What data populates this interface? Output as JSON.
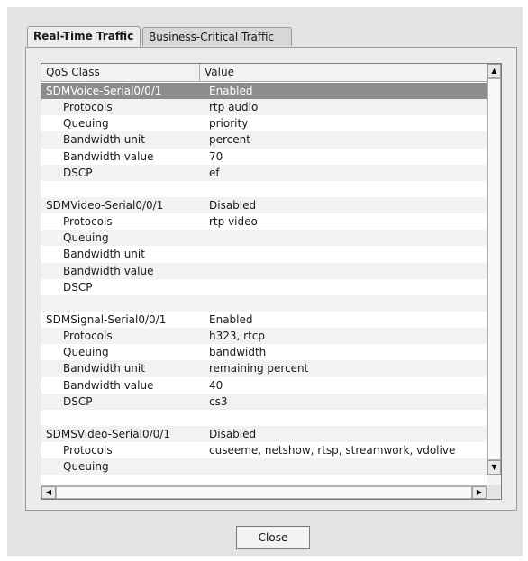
{
  "tabs": [
    {
      "label": "Real-Time Traffic",
      "active": true
    },
    {
      "label": "Business-Critical Traffic",
      "active": false
    }
  ],
  "table": {
    "columns": [
      "QoS Class",
      "Value"
    ],
    "rows": [
      {
        "key": "SDMVoice-Serial0/0/1",
        "value": "Enabled",
        "level": 0,
        "selected": true
      },
      {
        "key": "Protocols",
        "value": "rtp audio",
        "level": 1
      },
      {
        "key": "Queuing",
        "value": "priority",
        "level": 1
      },
      {
        "key": "Bandwidth unit",
        "value": "percent",
        "level": 1
      },
      {
        "key": "Bandwidth value",
        "value": "70",
        "level": 1
      },
      {
        "key": "DSCP",
        "value": "ef",
        "level": 1
      },
      {
        "key": "",
        "value": "",
        "level": 0
      },
      {
        "key": "SDMVideo-Serial0/0/1",
        "value": "Disabled",
        "level": 0
      },
      {
        "key": "Protocols",
        "value": "rtp video",
        "level": 1
      },
      {
        "key": "Queuing",
        "value": "",
        "level": 1
      },
      {
        "key": "Bandwidth unit",
        "value": "",
        "level": 1
      },
      {
        "key": "Bandwidth value",
        "value": "",
        "level": 1
      },
      {
        "key": "DSCP",
        "value": "",
        "level": 1
      },
      {
        "key": "",
        "value": "",
        "level": 0
      },
      {
        "key": "SDMSignal-Serial0/0/1",
        "value": "Enabled",
        "level": 0
      },
      {
        "key": "Protocols",
        "value": "h323, rtcp",
        "level": 1
      },
      {
        "key": "Queuing",
        "value": "bandwidth",
        "level": 1
      },
      {
        "key": "Bandwidth unit",
        "value": "remaining percent",
        "level": 1
      },
      {
        "key": "Bandwidth value",
        "value": "40",
        "level": 1
      },
      {
        "key": "DSCP",
        "value": "cs3",
        "level": 1
      },
      {
        "key": "",
        "value": "",
        "level": 0
      },
      {
        "key": "SDMSVideo-Serial0/0/1",
        "value": "Disabled",
        "level": 0
      },
      {
        "key": "Protocols",
        "value": "cuseeme, netshow, rtsp, streamwork, vdolive",
        "level": 1
      },
      {
        "key": "Queuing",
        "value": "",
        "level": 1
      }
    ]
  },
  "scroll_icons": {
    "up": "▲",
    "down": "▼",
    "left": "◀",
    "right": "▶"
  },
  "buttons": {
    "close_label": "Close"
  },
  "colors": {
    "selected_row": "#8c8c8c",
    "dialog_bg": "#e4e4e4"
  }
}
